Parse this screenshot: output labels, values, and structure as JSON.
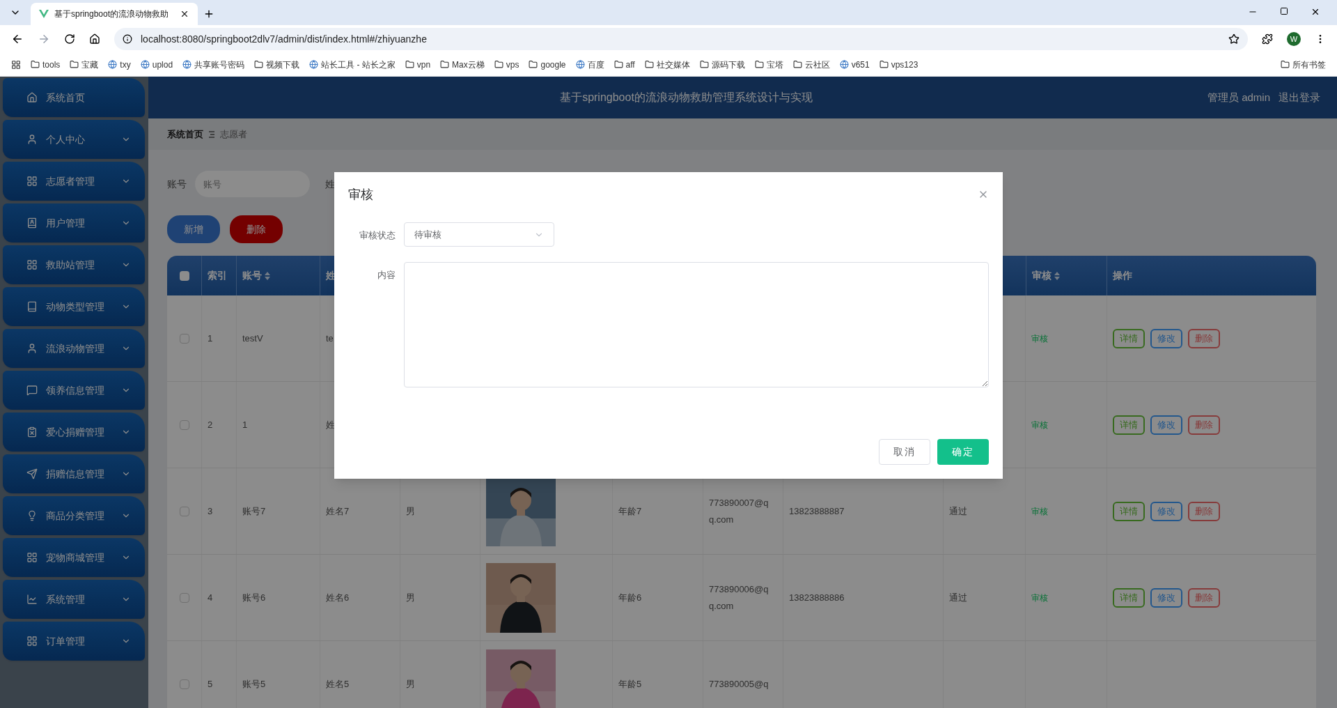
{
  "browser": {
    "tab_title": "基于springboot的流浪动物救助",
    "url": "localhost:8080/springboot2dlv7/admin/dist/index.html#/zhiyuanzhe",
    "profile": "W",
    "bookmarks": [
      {
        "label": "tools",
        "kind": "folder"
      },
      {
        "label": "宝藏",
        "kind": "folder"
      },
      {
        "label": "txy",
        "kind": "site"
      },
      {
        "label": "uplod",
        "kind": "site"
      },
      {
        "label": "共享账号密码",
        "kind": "site"
      },
      {
        "label": "视频下载",
        "kind": "folder"
      },
      {
        "label": "站长工具 - 站长之家",
        "kind": "site"
      },
      {
        "label": "vpn",
        "kind": "folder"
      },
      {
        "label": "Max云梯",
        "kind": "folder"
      },
      {
        "label": "vps",
        "kind": "folder"
      },
      {
        "label": "google",
        "kind": "folder"
      },
      {
        "label": "百度",
        "kind": "site"
      },
      {
        "label": "aff",
        "kind": "folder"
      },
      {
        "label": "社交媒体",
        "kind": "folder"
      },
      {
        "label": "源码下载",
        "kind": "folder"
      },
      {
        "label": "宝塔",
        "kind": "folder"
      },
      {
        "label": "云社区",
        "kind": "folder"
      },
      {
        "label": "v651",
        "kind": "site"
      },
      {
        "label": "vps123",
        "kind": "folder"
      }
    ],
    "all_bookmarks": "所有书签"
  },
  "sidebar": {
    "items": [
      {
        "label": "系统首页",
        "kind": "link"
      },
      {
        "label": "个人中心",
        "kind": "menu"
      },
      {
        "label": "志愿者管理",
        "kind": "menu"
      },
      {
        "label": "用户管理",
        "kind": "menu"
      },
      {
        "label": "救助站管理",
        "kind": "menu"
      },
      {
        "label": "动物类型管理",
        "kind": "menu"
      },
      {
        "label": "流浪动物管理",
        "kind": "menu"
      },
      {
        "label": "领养信息管理",
        "kind": "menu"
      },
      {
        "label": "爱心捐赠管理",
        "kind": "menu"
      },
      {
        "label": "捐赠信息管理",
        "kind": "menu"
      },
      {
        "label": "商品分类管理",
        "kind": "menu"
      },
      {
        "label": "宠物商城管理",
        "kind": "menu"
      },
      {
        "label": "系统管理",
        "kind": "menu"
      },
      {
        "label": "订单管理",
        "kind": "menu"
      }
    ]
  },
  "header": {
    "title": "基于springboot的流浪动物救助管理系统设计与实现",
    "user": "管理员 admin",
    "logout": "退出登录"
  },
  "breadcrumb": [
    "系统首页",
    "志愿者"
  ],
  "search": {
    "label": "账号",
    "placeholder": "账号",
    "label_2": "姓"
  },
  "actions": [
    "新增",
    "删除"
  ],
  "table": {
    "select_all_checked": false,
    "header": {
      "index": "索引",
      "account": "账号",
      "name": "姓",
      "review": "审核",
      "operations": "操作"
    },
    "rows": [
      {
        "checked": false,
        "index": "1",
        "account": "testV",
        "name": "te",
        "review": "审核",
        "buttons": [
          "详情",
          "修改",
          "删除"
        ]
      },
      {
        "checked": false,
        "index": "2",
        "account": "1",
        "name": "姓",
        "review": "审核",
        "buttons": [
          "详情",
          "修改",
          "删除"
        ]
      },
      {
        "checked": false,
        "index": "3",
        "account": "账号7",
        "name": "姓名7",
        "gender": "男",
        "age": "年龄7",
        "email": "773890007@qq.com",
        "phone": "13823888887",
        "status": "通过",
        "review": "审核",
        "buttons": [
          "详情",
          "修改",
          "删除"
        ]
      },
      {
        "checked": false,
        "index": "4",
        "account": "账号6",
        "name": "姓名6",
        "gender": "男",
        "age": "年龄6",
        "email": "773890006@qq.com",
        "phone": "13823888886",
        "status": "通过",
        "review": "审核",
        "buttons": [
          "详情",
          "修改",
          "删除"
        ]
      },
      {
        "checked": false,
        "index": "5",
        "account": "账号5",
        "name": "姓名5",
        "gender": "男",
        "age": "年龄5",
        "email": "773890005@q"
      }
    ]
  },
  "dialog": {
    "title": "审核",
    "fields": [
      {
        "label": "审核状态",
        "kind": "select",
        "value": "待审核"
      },
      {
        "label": "内容",
        "kind": "textarea"
      }
    ],
    "buttons": [
      {
        "label": "取消",
        "kind": "secondary"
      },
      {
        "label": "确定",
        "kind": "primary"
      }
    ]
  }
}
